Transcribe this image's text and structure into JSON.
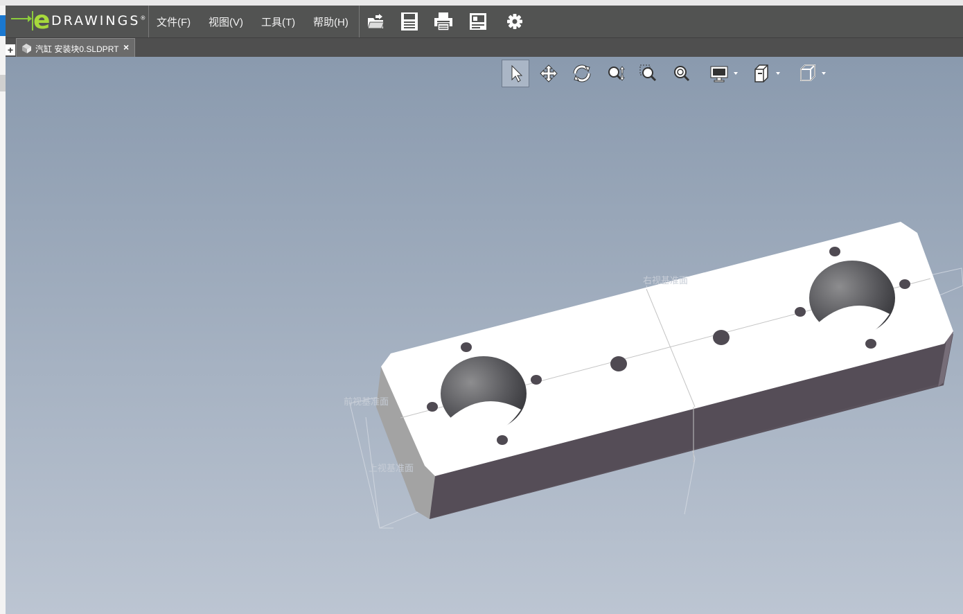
{
  "logo": {
    "mark": "e",
    "word": "DRAWINGS",
    "reg": "®"
  },
  "menu": {
    "items": [
      {
        "label": "文件(F)"
      },
      {
        "label": "视图(V)"
      },
      {
        "label": "工具(T)"
      },
      {
        "label": "帮助(H)"
      }
    ]
  },
  "toolbar": {
    "icons": [
      "open-icon",
      "save-icon",
      "print-icon",
      "markup-icon",
      "settings-icon"
    ]
  },
  "tabs": {
    "new_tab_label": "+",
    "document": {
      "label": "汽缸 安装块0.SLDPRT",
      "close": "×",
      "icon": "part-icon"
    }
  },
  "view_tools": {
    "icons": [
      "select-icon",
      "pan-icon",
      "rotate-icon",
      "zoom-icon",
      "zoom-to-area-icon",
      "zoom-to-fit-icon",
      "display-style-icon",
      "section-icon",
      "standard-views-icon"
    ],
    "selected": "select-icon"
  },
  "model_labels": {
    "top_plane": "右视基准面",
    "front_plane": "前视基准面",
    "bottom_plane": "上视基准面"
  },
  "colors": {
    "menubar": "#525352",
    "tabbar": "#4f4f4f",
    "viewport_top": "#8a9aae",
    "viewport_bottom": "#bcc5d2",
    "logo_green": "#a7d93c"
  }
}
